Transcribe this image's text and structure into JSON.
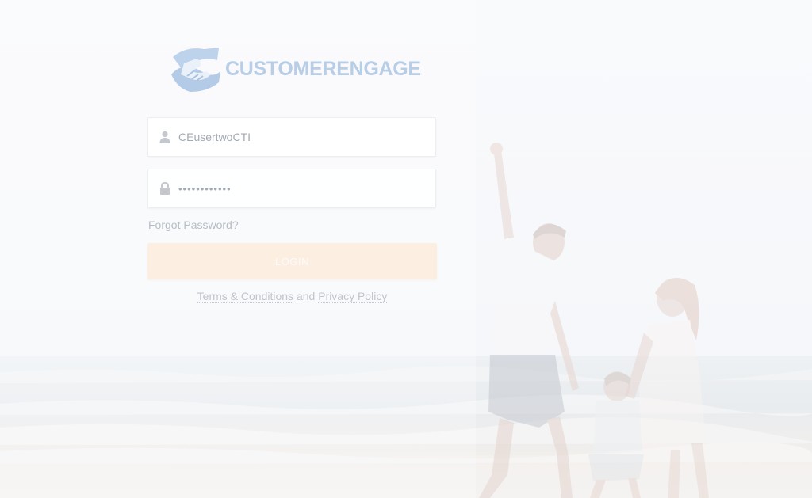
{
  "brand": {
    "logo_text": "CUSTOMERENGAGE",
    "logo_color": "#b8cde6",
    "icon": "handshake-logo-icon"
  },
  "login_form": {
    "username_value": "CEusertwoCTI",
    "username_icon": "user-icon",
    "password_value": "••••••••••••",
    "password_icon": "lock-icon",
    "forgot_password_label": "Forgot Password?",
    "login_button_label": "LOGIN",
    "login_button_color": "#fdeee2"
  },
  "legal": {
    "terms_label": "Terms & Conditions",
    "and_label": "and",
    "privacy_label": "Privacy Policy"
  },
  "background": {
    "description_icon": "beach-family-photo"
  }
}
